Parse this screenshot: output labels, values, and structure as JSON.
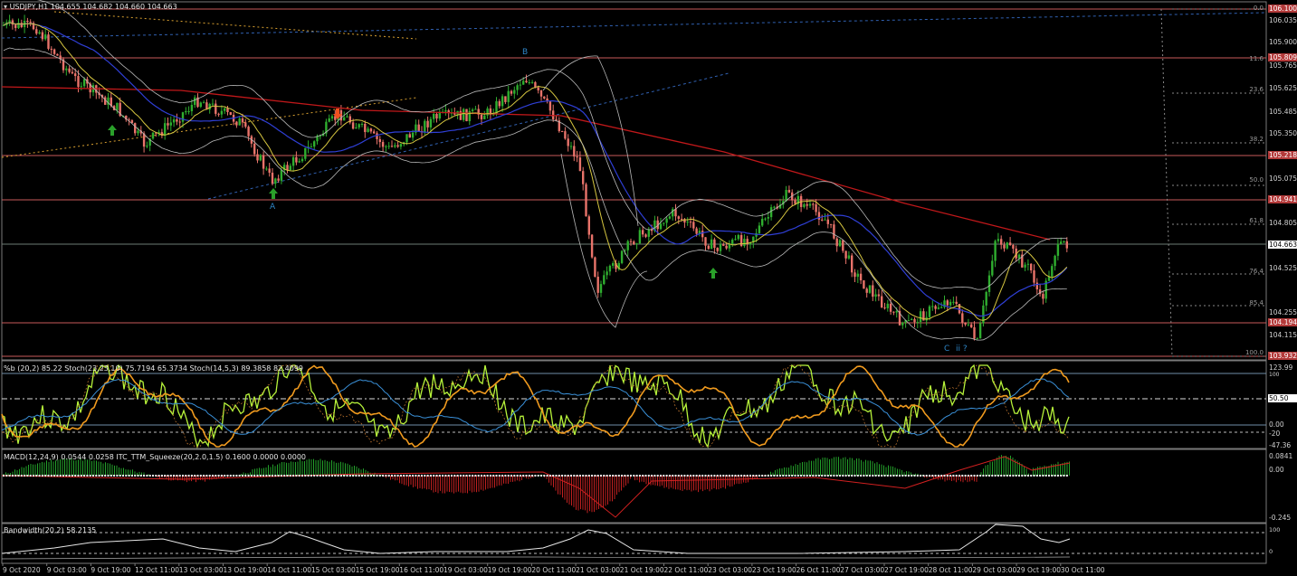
{
  "header": {
    "symbol_line": "USDJPY,H1  104.655 104.682 104.660 104.663"
  },
  "main_chart": {
    "current_price": "104.663",
    "price_ticks": [
      "106.035",
      "105.900",
      "105.765",
      "105.625",
      "105.485",
      "105.350",
      "105.075",
      "104.805",
      "104.525",
      "104.255",
      "104.115"
    ],
    "level_boxes": [
      {
        "label": "106.100",
        "color": "#b33a3a"
      },
      {
        "label": "105.809",
        "color": "#b33a3a"
      },
      {
        "label": "105.218",
        "color": "#b33a3a"
      },
      {
        "label": "104.941",
        "color": "#b33a3a"
      },
      {
        "label": "104.194",
        "color": "#b33a3a"
      },
      {
        "label": "103.932",
        "color": "#b33a3a"
      }
    ],
    "fib_labels": [
      "0.0",
      "23.6",
      "38.2",
      "50.0",
      "61.8",
      "76.4",
      "85.4",
      "100.0",
      "11.6"
    ],
    "wave_labels": [
      "A",
      "B",
      "C",
      "ii ?"
    ]
  },
  "stoch_panel": {
    "title": "%b (20,2) 85.22  Stoch(23,23,10) 75.7194 65.3734  Stoch(14,5,3) 89.3858 82.4099",
    "ticks": [
      "123.99",
      "100",
      "50.50",
      "0.00",
      "-20",
      "-47.36"
    ]
  },
  "macd_panel": {
    "title": "MACD(12,24,9) 0.0544 0.0258  ITC_TTM_Squeeze(20,2.0,1.5) 0.1600 0.0000 0.0000",
    "ticks": [
      "0.0841",
      "0.00",
      "-0.245"
    ]
  },
  "bandwidth_panel": {
    "title": "Bandwidth(20,2) 58.2135",
    "ticks": [
      "100",
      "0"
    ]
  },
  "time_axis": [
    "9 Oct 2020",
    "9 Oct 03:00",
    "9 Oct 19:00",
    "12 Oct 11:00",
    "13 Oct 03:00",
    "13 Oct 19:00",
    "14 Oct 11:00",
    "15 Oct 03:00",
    "15 Oct 19:00",
    "16 Oct 11:00",
    "19 Oct 03:00",
    "19 Oct 19:00",
    "20 Oct 11:00",
    "21 Oct 03:00",
    "21 Oct 19:00",
    "22 Oct 11:00",
    "23 Oct 03:00",
    "23 Oct 19:00",
    "26 Oct 11:00",
    "27 Oct 03:00",
    "27 Oct 19:00",
    "28 Oct 11:00",
    "29 Oct 03:00",
    "29 Oct 19:00",
    "30 Oct 11:00"
  ],
  "colors": {
    "bull": "#2fae2f",
    "bear": "#e8736a",
    "ma_red": "#c0181a",
    "ma_blue": "#2f3fd6",
    "ma_yellow": "#d6c640",
    "band": "#b8b8b8",
    "level_line": "#c85a5a",
    "stoch_green": "#b6f23a",
    "stoch_orange": "#f09a1e",
    "stoch_blue": "#3a90d8"
  }
}
